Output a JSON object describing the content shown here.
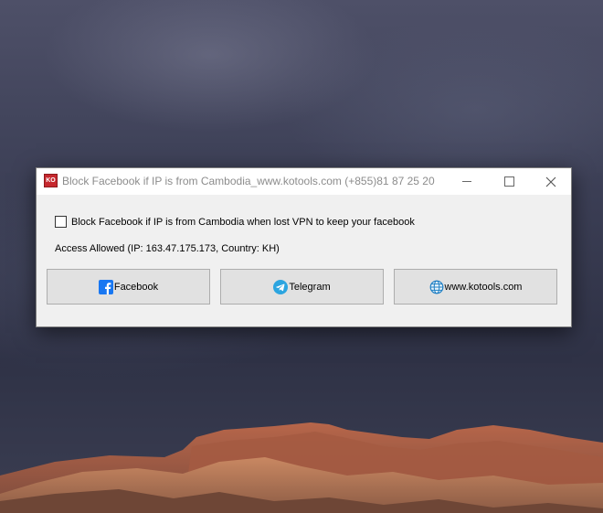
{
  "window": {
    "title": "Block Facebook if IP is from Cambodia_www.kotools.com (+855)81 87 25 20",
    "app_icon_text": "KO"
  },
  "options": {
    "block_checkbox_label": "Block Facebook if IP is from Cambodia when lost VPN to keep your facebook",
    "block_checkbox_checked": false
  },
  "status": {
    "text": "Access Allowed (IP: 163.47.175.173, Country: KH)"
  },
  "buttons": [
    {
      "label": "Facebook",
      "icon": "facebook-icon"
    },
    {
      "label": "Telegram",
      "icon": "telegram-icon"
    },
    {
      "label": "www.kotools.com",
      "icon": "globe-icon"
    }
  ],
  "colors": {
    "facebook_blue": "#1877f2",
    "telegram_blue": "#2ca5e0",
    "app_icon_red": "#c6282e",
    "title_text_gray": "#8c8c8c"
  }
}
